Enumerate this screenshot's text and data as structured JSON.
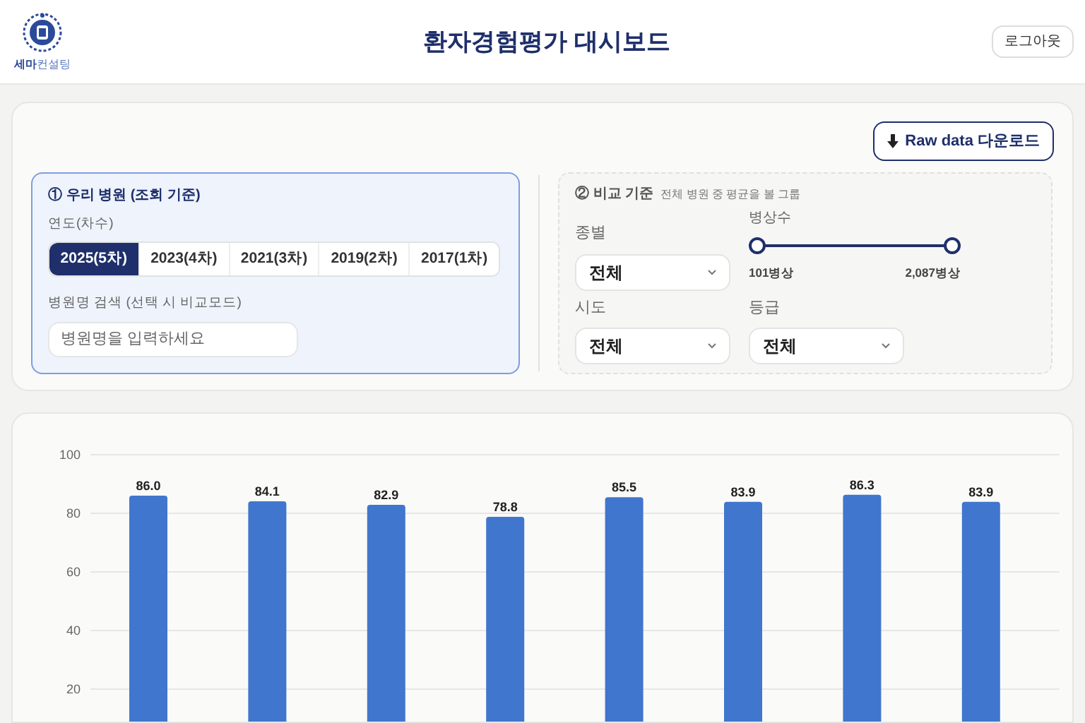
{
  "header": {
    "logo_text_bold": "세마",
    "logo_text": "컨설팅",
    "title": "환자경험평가 대시보드",
    "logout": "로그아웃"
  },
  "download_button": {
    "label": "Raw data 다운로드"
  },
  "our_hospital": {
    "title": "① 우리 병원 (조회 기준)",
    "year_label": "연도(차수)",
    "years": [
      {
        "label": "2025(5차)",
        "selected": true
      },
      {
        "label": "2023(4차)",
        "selected": false
      },
      {
        "label": "2021(3차)",
        "selected": false
      },
      {
        "label": "2019(2차)",
        "selected": false
      },
      {
        "label": "2017(1차)",
        "selected": false
      }
    ],
    "search_label": "병원명 검색 (선택 시 비교모드)",
    "search": {
      "placeholder": "병원명을 입력하세요"
    }
  },
  "comparison": {
    "title": "② 비교 기준",
    "subtitle": "전체 병원 중 평균을 볼 그룹",
    "type": {
      "label": "종별",
      "value": "전체"
    },
    "beds": {
      "label": "병상수",
      "thumbs": [
        {
          "level": 0
        },
        {
          "level": 1
        }
      ],
      "min": "101병상",
      "max": "2,087병상"
    },
    "region": {
      "label": "시도",
      "value": "전체"
    },
    "grade": {
      "label": "등급",
      "value": "전체"
    }
  },
  "chart": {
    "chart_data": {
      "type": "bar",
      "ylim": [
        0,
        100
      ],
      "yticks": [
        20,
        40,
        60,
        80,
        100
      ],
      "grid": true,
      "series": [
        {
          "color": "#4176ce",
          "values": [
            86.0,
            84.1,
            82.9,
            78.8,
            85.5,
            83.9,
            86.3,
            83.9
          ]
        }
      ],
      "value_labels": [
        "86.0",
        "84.1",
        "82.9",
        "78.8",
        "85.5",
        "83.9",
        "86.3",
        "83.9"
      ]
    }
  }
}
